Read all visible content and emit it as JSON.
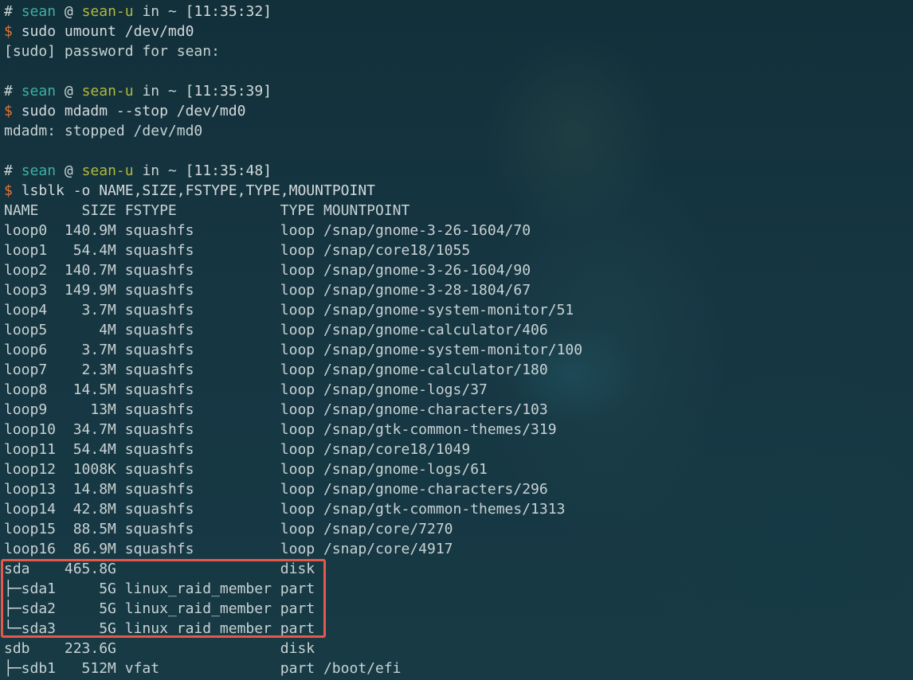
{
  "prompt1": {
    "hash": "#",
    "user": "sean",
    "at": "@",
    "host": "sean-u",
    "in": "in",
    "path": "~",
    "time": "[11:35:32]"
  },
  "cmd1": {
    "dollar": "$",
    "text": "sudo umount /dev/md0"
  },
  "out1": [
    "[sudo] password for sean:"
  ],
  "prompt2": {
    "hash": "#",
    "user": "sean",
    "at": "@",
    "host": "sean-u",
    "in": "in",
    "path": "~",
    "time": "[11:35:39]"
  },
  "cmd2": {
    "dollar": "$",
    "text": "sudo mdadm --stop /dev/md0"
  },
  "out2": [
    "mdadm: stopped /dev/md0"
  ],
  "prompt3": {
    "hash": "#",
    "user": "sean",
    "at": "@",
    "host": "sean-u",
    "in": "in",
    "path": "~",
    "time": "[11:35:48]"
  },
  "cmd3": {
    "dollar": "$",
    "text": "lsblk -o NAME,SIZE,FSTYPE,TYPE,MOUNTPOINT"
  },
  "lsblk": {
    "header": "NAME     SIZE FSTYPE            TYPE MOUNTPOINT",
    "rows": [
      "loop0  140.9M squashfs          loop /snap/gnome-3-26-1604/70",
      "loop1   54.4M squashfs          loop /snap/core18/1055",
      "loop2  140.7M squashfs          loop /snap/gnome-3-26-1604/90",
      "loop3  149.9M squashfs          loop /snap/gnome-3-28-1804/67",
      "loop4    3.7M squashfs          loop /snap/gnome-system-monitor/51",
      "loop5      4M squashfs          loop /snap/gnome-calculator/406",
      "loop6    3.7M squashfs          loop /snap/gnome-system-monitor/100",
      "loop7    2.3M squashfs          loop /snap/gnome-calculator/180",
      "loop8   14.5M squashfs          loop /snap/gnome-logs/37",
      "loop9     13M squashfs          loop /snap/gnome-characters/103",
      "loop10  34.7M squashfs          loop /snap/gtk-common-themes/319",
      "loop11  54.4M squashfs          loop /snap/core18/1049",
      "loop12  1008K squashfs          loop /snap/gnome-logs/61",
      "loop13  14.8M squashfs          loop /snap/gnome-characters/296",
      "loop14  42.8M squashfs          loop /snap/gtk-common-themes/1313",
      "loop15  88.5M squashfs          loop /snap/core/7270",
      "loop16  86.9M squashfs          loop /snap/core/4917",
      "sda    465.8G                   disk",
      "├─sda1     5G linux_raid_member part",
      "├─sda2     5G linux_raid_member part",
      "└─sda3     5G linux_raid_member part",
      "sdb    223.6G                   disk",
      "├─sdb1   512M vfat              part /boot/efi"
    ]
  },
  "colors": {
    "user": "#3fb0a5",
    "host": "#b3b83a",
    "dollar": "#e3743b",
    "highlight": "#e8584a",
    "background": "#163642"
  }
}
